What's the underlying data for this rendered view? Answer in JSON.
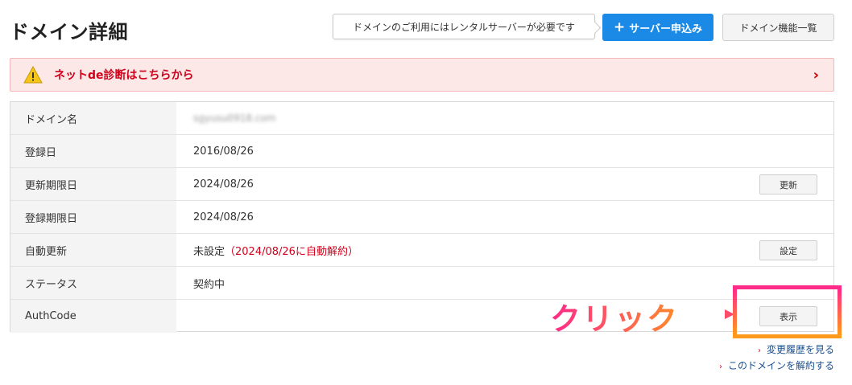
{
  "header": {
    "title": "ドメイン詳細",
    "notice": "ドメインのご利用にはレンタルサーバーが必要です",
    "primary_btn": "サーバー申込み",
    "secondary_btn": "ドメイン機能一覧"
  },
  "alert": {
    "text": "ネットde診断はこちらから",
    "icon": "warning-icon"
  },
  "details": {
    "rows": [
      {
        "label": "ドメイン名",
        "value": "sgyusu0918.com"
      },
      {
        "label": "登録日",
        "value": "2016/08/26"
      },
      {
        "label": "更新期限日",
        "value": "2024/08/26",
        "action": "更新"
      },
      {
        "label": "登録期限日",
        "value": "2024/08/26"
      },
      {
        "label": "自動更新",
        "value": "未設定",
        "value_note": "（2024/08/26に自動解約）",
        "action": "設定"
      },
      {
        "label": "ステータス",
        "value": "契約中"
      },
      {
        "label": "AuthCode",
        "value": "",
        "action": "表示"
      }
    ]
  },
  "annotation": {
    "text": "クリック"
  },
  "links": {
    "history": "変更履歴を見る",
    "cancel": "このドメインを解約する"
  },
  "colors": {
    "primary": "#1a8ae6",
    "alert_bg": "#fde8e8",
    "alert_text": "#d0021b",
    "annotation_start": "#ff2a8a",
    "annotation_end": "#ff9a1a"
  }
}
